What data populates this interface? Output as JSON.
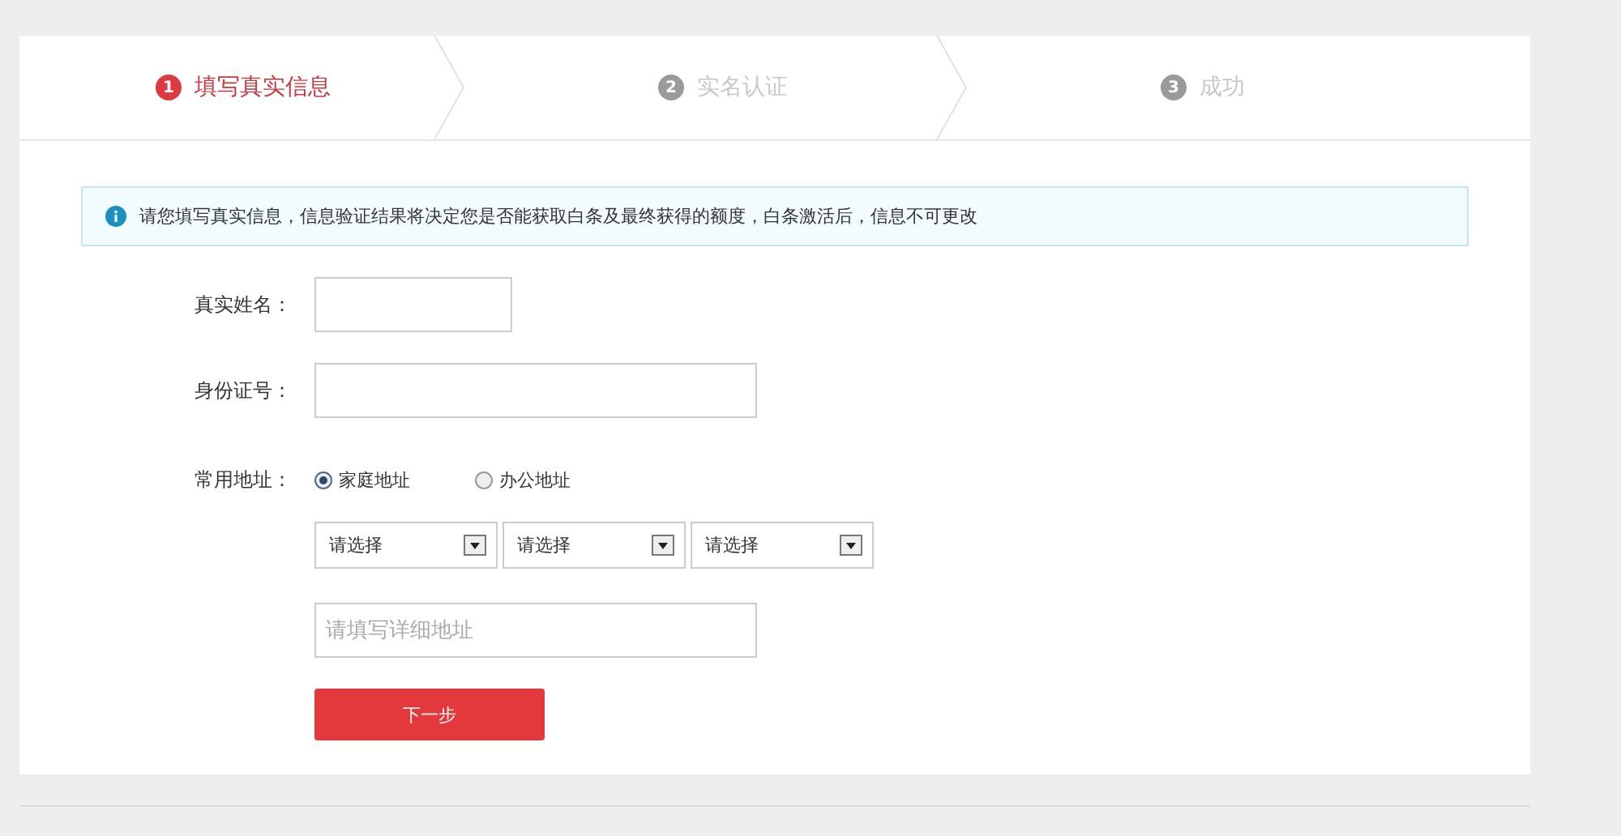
{
  "steps": [
    {
      "number": "1",
      "label": "填写真实信息",
      "selected": true
    },
    {
      "number": "2",
      "label": "实名认证",
      "selected": false
    },
    {
      "number": "3",
      "label": "成功",
      "selected": false
    }
  ],
  "notice": {
    "text": "请您填写真实信息，信息验证结果将决定您是否能获取白条及最终获得的额度，白条激活后，信息不可更改"
  },
  "form": {
    "name_label": "真实姓名：",
    "id_label": "身份证号：",
    "address_label": "常用地址：",
    "address_types": [
      {
        "label": "家庭地址",
        "selected": true
      },
      {
        "label": "办公地址",
        "selected": false
      }
    ],
    "region_selects": [
      {
        "value": "请选择"
      },
      {
        "value": "请选择"
      },
      {
        "value": "请选择"
      }
    ],
    "detail_address": {
      "placeholder": "请填写详细地址"
    },
    "submit": "下一步"
  }
}
